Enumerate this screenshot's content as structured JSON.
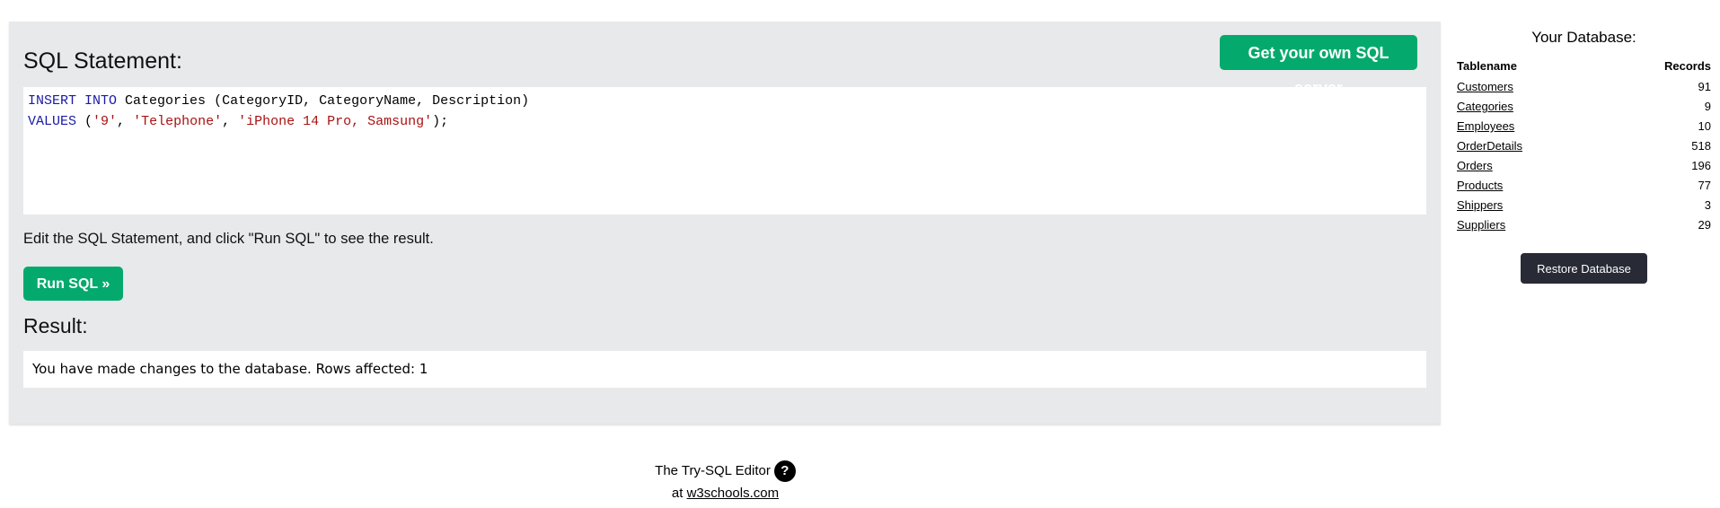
{
  "editor": {
    "title": "SQL Statement:",
    "own_server_label": "Get your own SQL server",
    "code": {
      "l1_kw1": "INSERT",
      "l1_kw2": "INTO",
      "l1_rest": " Categories (CategoryID, CategoryName, Description)",
      "l2_kw": "VALUES",
      "l2_open": " (",
      "l2_s1": "'9'",
      "l2_sep1": ", ",
      "l2_s2": "'Telephone'",
      "l2_sep2": ", ",
      "l2_s3": "'iPhone 14 Pro, Samsung'",
      "l2_close": ");"
    },
    "instructions": "Edit the SQL Statement, and click \"Run SQL\" to see the result.",
    "run_label": "Run SQL »"
  },
  "result": {
    "title": "Result:",
    "message": "You have made changes to the database. Rows affected: 1"
  },
  "database": {
    "title": "Your Database:",
    "col_table": "Tablename",
    "col_records": "Records",
    "rows": [
      {
        "name": "Customers",
        "records": "91"
      },
      {
        "name": "Categories",
        "records": "9"
      },
      {
        "name": "Employees",
        "records": "10"
      },
      {
        "name": "OrderDetails",
        "records": "518"
      },
      {
        "name": "Orders",
        "records": "196"
      },
      {
        "name": "Products",
        "records": "77"
      },
      {
        "name": "Shippers",
        "records": "3"
      },
      {
        "name": "Suppliers",
        "records": "29"
      }
    ],
    "restore_label": "Restore Database"
  },
  "footer": {
    "line1": "The Try-SQL Editor",
    "help_glyph": "?",
    "at": "at ",
    "link": "w3schools.com"
  }
}
